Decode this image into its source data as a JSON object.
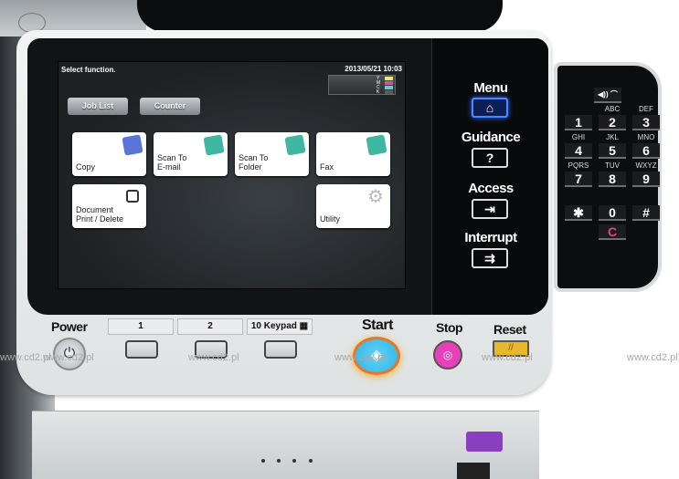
{
  "screen": {
    "prompt": "Select function.",
    "datetime": "2013/05/21 10:03",
    "toner": [
      {
        "label": "Y",
        "color": "#e6ec6a"
      },
      {
        "label": "M",
        "color": "#d84fa0"
      },
      {
        "label": "C",
        "color": "#5fd0d0"
      },
      {
        "label": "K",
        "color": "#555b5e"
      }
    ],
    "tabs": [
      {
        "label": "Job List"
      },
      {
        "label": "Counter"
      }
    ],
    "functions": [
      {
        "label": "Copy",
        "icon": "copy-icon",
        "color": "#5a74d8"
      },
      {
        "label": "Scan To\nE-mail",
        "icon": "email-icon",
        "color": "#3fb7a1"
      },
      {
        "label": "Scan To\nFolder",
        "icon": "folder-icon",
        "color": "#3fb7a1"
      },
      {
        "label": "Fax",
        "icon": "fax-icon",
        "color": "#3fb7a1"
      },
      {
        "label": "Document\nPrint / Delete",
        "icon": "printer-icon",
        "color": "#ffffff"
      },
      {
        "label": "Utility",
        "icon": "gear-icon",
        "color": "#ffffff"
      }
    ]
  },
  "hardkeys": [
    {
      "label": "Menu",
      "glyph": "⌂"
    },
    {
      "label": "Guidance",
      "glyph": "?"
    },
    {
      "label": "Access",
      "glyph": "⇥"
    },
    {
      "label": "Interrupt",
      "glyph": "⇉"
    }
  ],
  "keypad": {
    "top_key": "◀)) ⌒",
    "keys": [
      {
        "num": "1",
        "sub": ""
      },
      {
        "num": "2",
        "sub": "ABC"
      },
      {
        "num": "3",
        "sub": "DEF"
      },
      {
        "num": "4",
        "sub": "GHI"
      },
      {
        "num": "5",
        "sub": "JKL"
      },
      {
        "num": "6",
        "sub": "MNO"
      },
      {
        "num": "7",
        "sub": "PQRS"
      },
      {
        "num": "8",
        "sub": "TUV"
      },
      {
        "num": "9",
        "sub": "WXYZ"
      },
      {
        "num": "✱",
        "sub": ""
      },
      {
        "num": "0",
        "sub": ""
      },
      {
        "num": "#",
        "sub": ""
      }
    ],
    "clear": "C"
  },
  "bottom": {
    "power": "Power",
    "register_keys": [
      "1",
      "2",
      "10 Keypad ▦"
    ],
    "start": "Start",
    "stop": "Stop",
    "reset": "Reset",
    "watermark": "www.cd2.pl"
  },
  "colors": {
    "start": "#3fc3ee",
    "stop": "#e840b8",
    "reset": "#e8b82a",
    "menu_active": "#2e6cff"
  }
}
